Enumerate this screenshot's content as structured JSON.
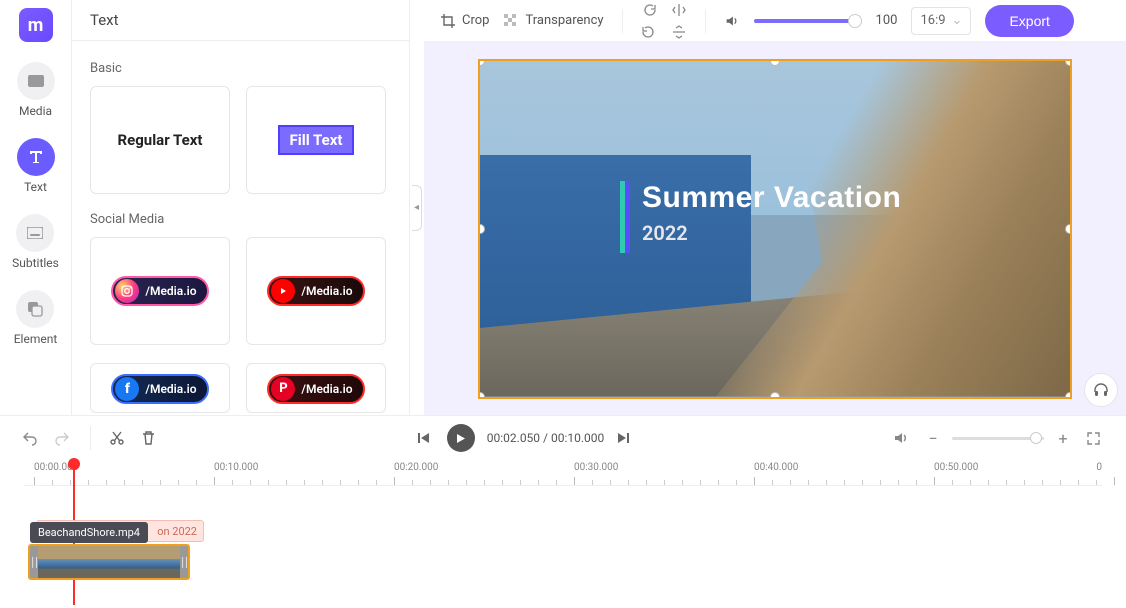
{
  "rail": {
    "media": "Media",
    "text": "Text",
    "subtitles": "Subtitles",
    "element": "Element"
  },
  "sidePanel": {
    "title": "Text",
    "section_basic": "Basic",
    "section_social": "Social Media",
    "tile_regular": "Regular Text",
    "tile_fill": "Fill Text",
    "social_ig": "/Media.io",
    "social_yt": "/Media.io",
    "social_fb": "/Media.io",
    "social_pt": "/Media.io"
  },
  "toolbar": {
    "crop": "Crop",
    "transparency": "Transparency",
    "opacity_value": "100",
    "aspect": "16:9",
    "export": "Export"
  },
  "canvas": {
    "overlay_title": "Summer Vacation",
    "overlay_year": "2022"
  },
  "playback": {
    "current": "00:02.050",
    "sep": " / ",
    "total": "00:10.000"
  },
  "ruler": {
    "t0": "00:00.000",
    "t10": "00:10.000",
    "t20": "00:20.000",
    "t30": "00:30.000",
    "t40": "00:40.000",
    "t50": "00:50.000",
    "tend": "0"
  },
  "timeline": {
    "text_clip_label": "on 2022",
    "tooltip": "BeachandShore.mp4"
  }
}
